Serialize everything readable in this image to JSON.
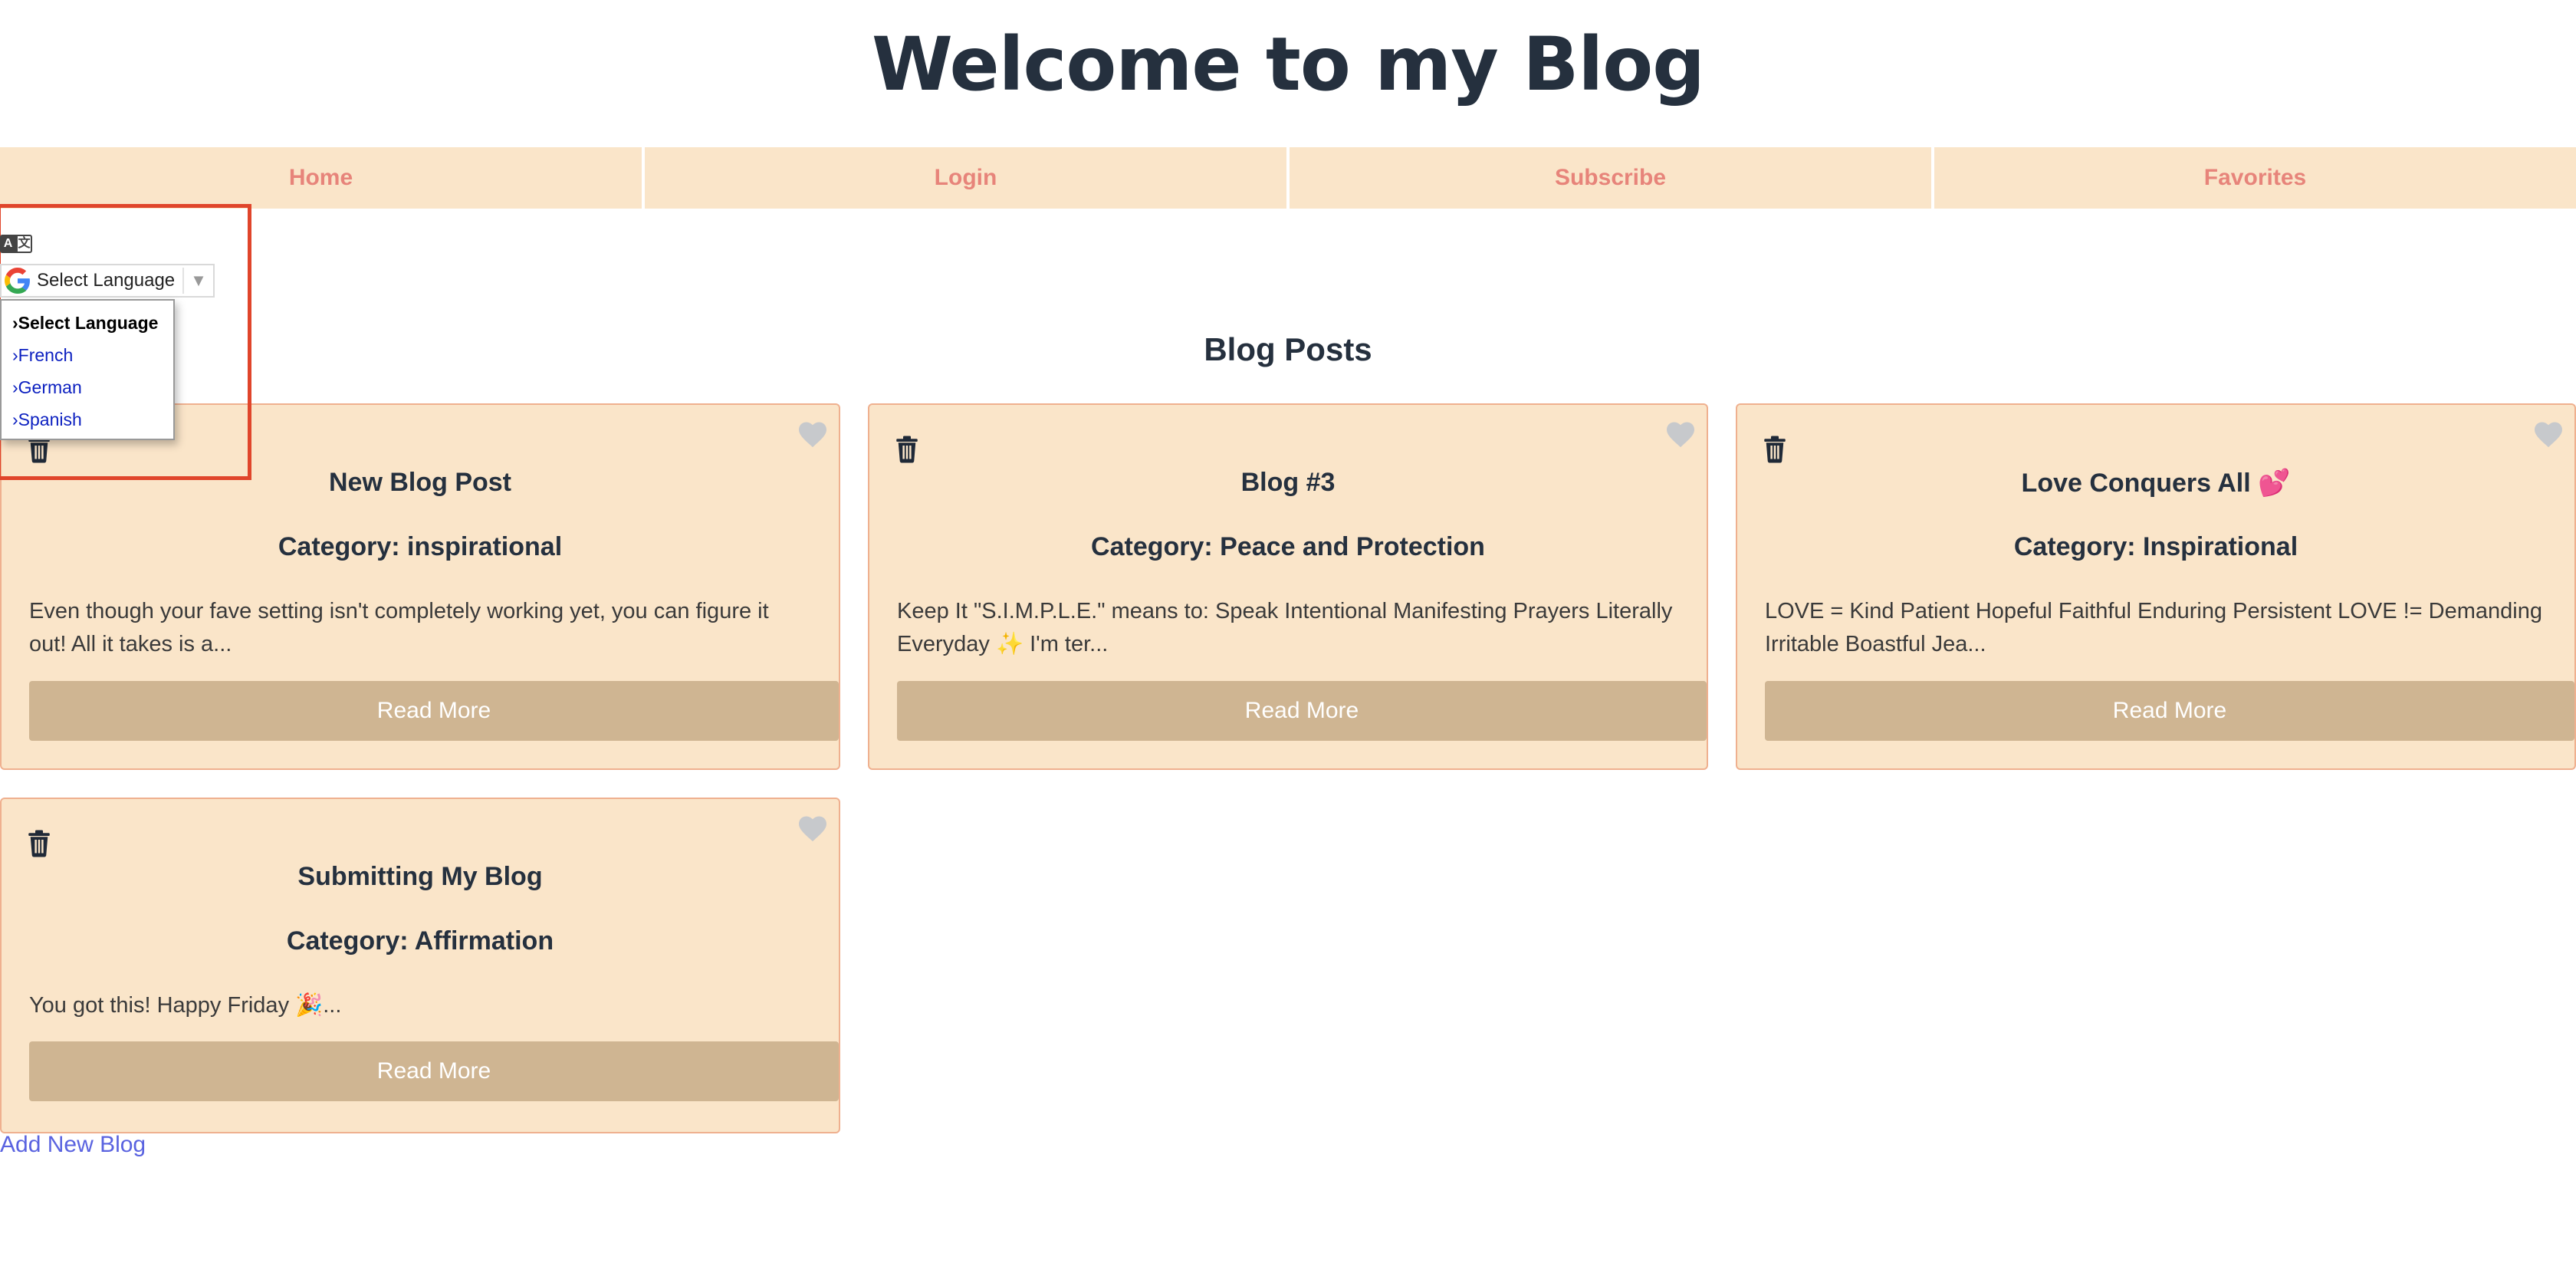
{
  "header": {
    "title": "Welcome to my Blog"
  },
  "nav": {
    "items": [
      {
        "label": "Home"
      },
      {
        "label": "Login"
      },
      {
        "label": "Subscribe"
      },
      {
        "label": "Favorites"
      }
    ]
  },
  "translate": {
    "select_label": "Select Language",
    "icon": "translate-icon",
    "options": [
      {
        "label": "›Select Language",
        "selected": true
      },
      {
        "label": "›French"
      },
      {
        "label": "›German"
      },
      {
        "label": "›Spanish"
      }
    ]
  },
  "main": {
    "section_title": "Blog Posts",
    "posts": [
      {
        "title": "New Blog Post",
        "category": "Category: inspirational",
        "excerpt": "Even though your fave setting isn't completely working yet, you can figure it out! All it takes is a...",
        "read_more": "Read More"
      },
      {
        "title": "Blog #3",
        "category": "Category: Peace and Protection",
        "excerpt": "Keep It \"S.I.M.P.L.E.\" means to: Speak Intentional Manifesting Prayers Literally Everyday ✨ I'm ter...",
        "read_more": "Read More"
      },
      {
        "title": "Love Conquers All 💕",
        "category": "Category: Inspirational",
        "excerpt": "LOVE = Kind Patient Hopeful Faithful Enduring Persistent LOVE != Demanding Irritable Boastful Jea...",
        "read_more": "Read More"
      },
      {
        "title": "Submitting My Blog",
        "category": "Category: Affirmation",
        "excerpt": "You got this! Happy Friday 🎉...",
        "read_more": "Read More"
      }
    ],
    "add_link": "Add New Blog"
  },
  "colors": {
    "card_bg": "#fae5c9",
    "card_border": "#efb08f",
    "nav_text": "#e7847a",
    "button_bg": "#cfb592",
    "link": "#5a63e0",
    "highlight_frame": "#e0452b"
  }
}
